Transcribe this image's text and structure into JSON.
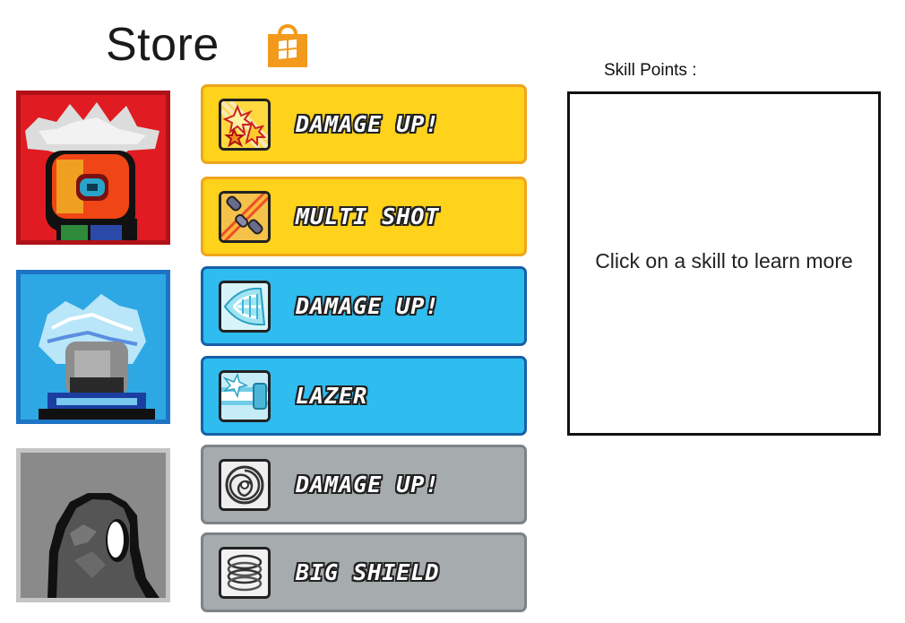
{
  "header": {
    "title": "Store",
    "store_icon": "store-bag-icon"
  },
  "skill_points": {
    "label": "Skill Points :",
    "value": ""
  },
  "info_panel": {
    "text": "Click on a skill to learn more"
  },
  "characters": [
    {
      "name": "red-character",
      "color": "#e01b22"
    },
    {
      "name": "blue-character",
      "color": "#2ea8e4"
    },
    {
      "name": "gray-character",
      "color": "#8a8a8a"
    }
  ],
  "skills": [
    {
      "label": "DAMAGE UP!",
      "icon": "explosion-icon",
      "color": "#ffd21c"
    },
    {
      "label": "MULTI SHOT",
      "icon": "multi-shot-icon",
      "color": "#ffd21c"
    },
    {
      "label": "DAMAGE UP!",
      "icon": "ice-blast-icon",
      "color": "#2fbcef"
    },
    {
      "label": "LAZER",
      "icon": "lazer-icon",
      "color": "#2fbcef"
    },
    {
      "label": "DAMAGE UP!",
      "icon": "vortex-icon",
      "color": "#a6abae"
    },
    {
      "label": "BIG SHIELD",
      "icon": "shield-icon",
      "color": "#a6abae"
    }
  ]
}
